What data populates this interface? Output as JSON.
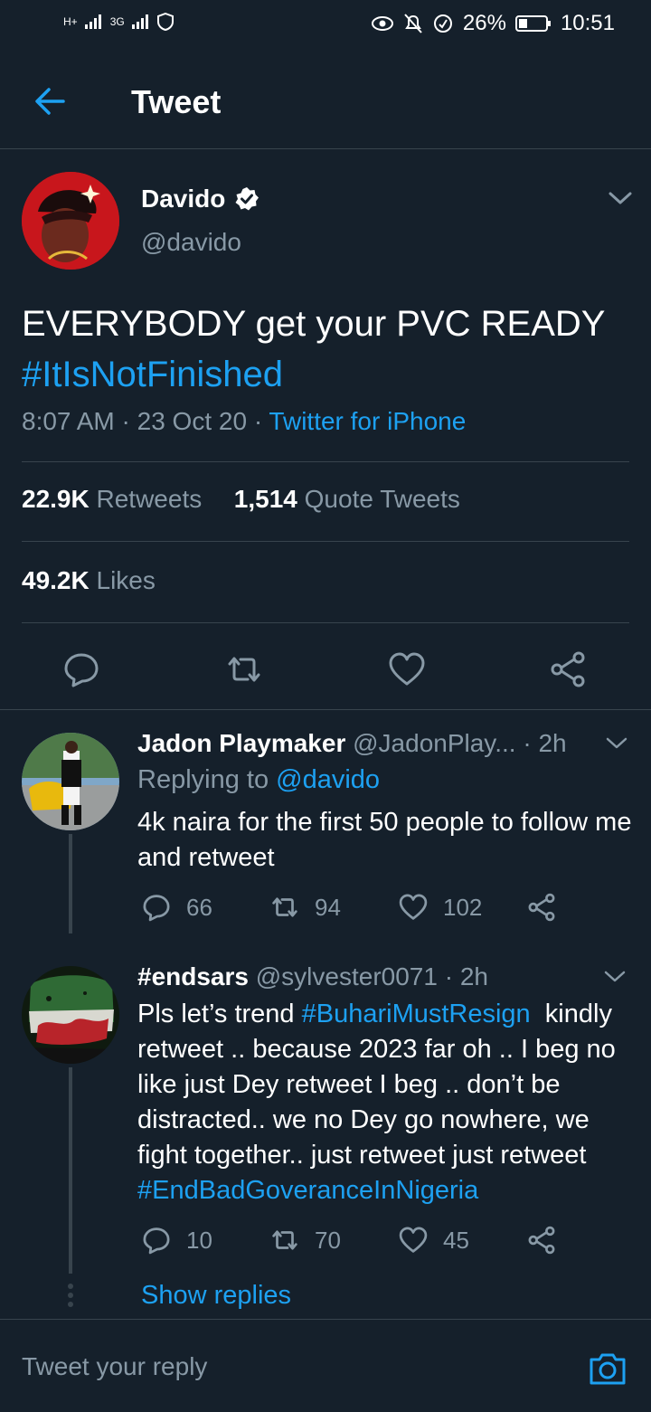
{
  "status": {
    "network1": "H+",
    "network2": "3G",
    "battery": "26%",
    "time": "10:51"
  },
  "header": {
    "title": "Tweet"
  },
  "main_tweet": {
    "name": "Davido",
    "handle": "@davido",
    "text_line1": "EVERYBODY get your PVC READY",
    "hashtag": "#ItIsNotFinished",
    "time": "8:07 AM",
    "date": "23 Oct 20",
    "source": "Twitter for iPhone",
    "retweets": "22.9K",
    "retweets_label": "Retweets",
    "quotes": "1,514",
    "quotes_label": "Quote Tweets",
    "likes": "49.2K",
    "likes_label": "Likes"
  },
  "replies": [
    {
      "name": "Jadon Playmaker",
      "handle": "@JadonPlay...",
      "time": "2h",
      "replying_label": "Replying to",
      "replying_to": "@davido",
      "text": "4k naira for the first 50 people to follow me and retweet",
      "replies": "66",
      "retweets": "94",
      "likes": "102"
    },
    {
      "name": "#endsars",
      "handle": "@sylvester0071",
      "time": "2h",
      "text_a": "Pls let’s trend ",
      "hashtag1": "#BuhariMustResign",
      "text_b": "  kindly retweet .. because 2023 far oh .. I beg no like just Dey retweet I beg .. don’t be distracted.. we no Dey go nowhere, we fight together.. just retweet just retweet ",
      "hashtag2": "#EndBadGoveranceInNigeria",
      "replies": "10",
      "retweets": "70",
      "likes": "45"
    }
  ],
  "show_replies": "Show replies",
  "compose": {
    "placeholder": "Tweet your reply"
  },
  "colors": {
    "background": "#15202b",
    "accent": "#1da1f2",
    "muted": "#8899a6",
    "divider": "#38444d"
  },
  "icons": [
    "back-arrow-icon",
    "verified-icon",
    "chevron-down-icon",
    "reply-icon",
    "retweet-icon",
    "like-icon",
    "share-icon",
    "camera-icon"
  ]
}
